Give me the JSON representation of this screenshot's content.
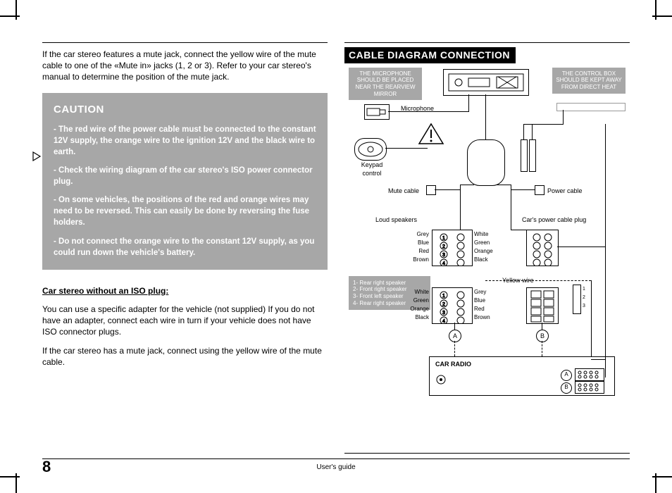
{
  "left": {
    "intro": "If the car stereo features a mute jack, connect the yellow wire of the mute cable to one of the «Mute in» jacks (1, 2 or 3). Refer to your car stereo's manual to determine the position of the mute jack.",
    "caution_title": "CAUTION",
    "caution_p1": "- The red wire of the power cable must be connected to the constant 12V supply, the orange wire to the ignition 12V and the black wire to earth.",
    "caution_p2": "- Check the wiring diagram of the car stereo's ISO power connector plug.",
    "caution_p3": "- On some vehicles, the positions of the red and orange wires may need to be reversed. This can easily be done by reversing the fuse holders.",
    "caution_p4": "- Do not connect the orange wire to the constant 12V supply, as you could run down the vehicle's battery.",
    "subhead": "Car stereo without an ISO plug:",
    "para1": "You can use a specific adapter for the vehicle (not supplied) If you do not have an adapter, connect each wire in turn if your vehicle does not have ISO connector plugs.",
    "para2": "If the car stereo has a mute jack, connect using the yellow wire of the mute cable."
  },
  "right": {
    "section_title": "CABLE DIAGRAM CONNECTION",
    "note_mic": "THE MICROPHONE SHOULD BE PLACED NEAR THE REARVIEW MIRROR",
    "note_ctrl": "THE CONTROL BOX SHOULD BE KEPT AWAY FROM DIRECT HEAT",
    "labels": {
      "microphone": "Microphone",
      "keypad": "Keypad control",
      "mute_cable": "Mute cable",
      "power_cable": "Power cable",
      "loud_speakers": "Loud speakers",
      "car_power_plug": "Car's power cable plug",
      "yellow_wire": "Yellow wire",
      "car_radio": "CAR RADIO",
      "A": "A",
      "B": "B"
    },
    "pins_left_upper": [
      "Grey",
      "Blue",
      "Red",
      "Brown"
    ],
    "pins_right_upper": [
      "White",
      "Green",
      "Orange",
      "Black"
    ],
    "pins_left_lower": [
      "White",
      "Green",
      "Orange",
      "Black"
    ],
    "pins_right_lower": [
      "Grey",
      "Blue",
      "Red",
      "Brown"
    ],
    "legend": [
      "1- Rear right speaker",
      "2- Front right speaker",
      "3- Front left speaker",
      "4- Rear right speaker"
    ]
  },
  "footer": {
    "page_number": "8",
    "guide": "User's guide"
  }
}
